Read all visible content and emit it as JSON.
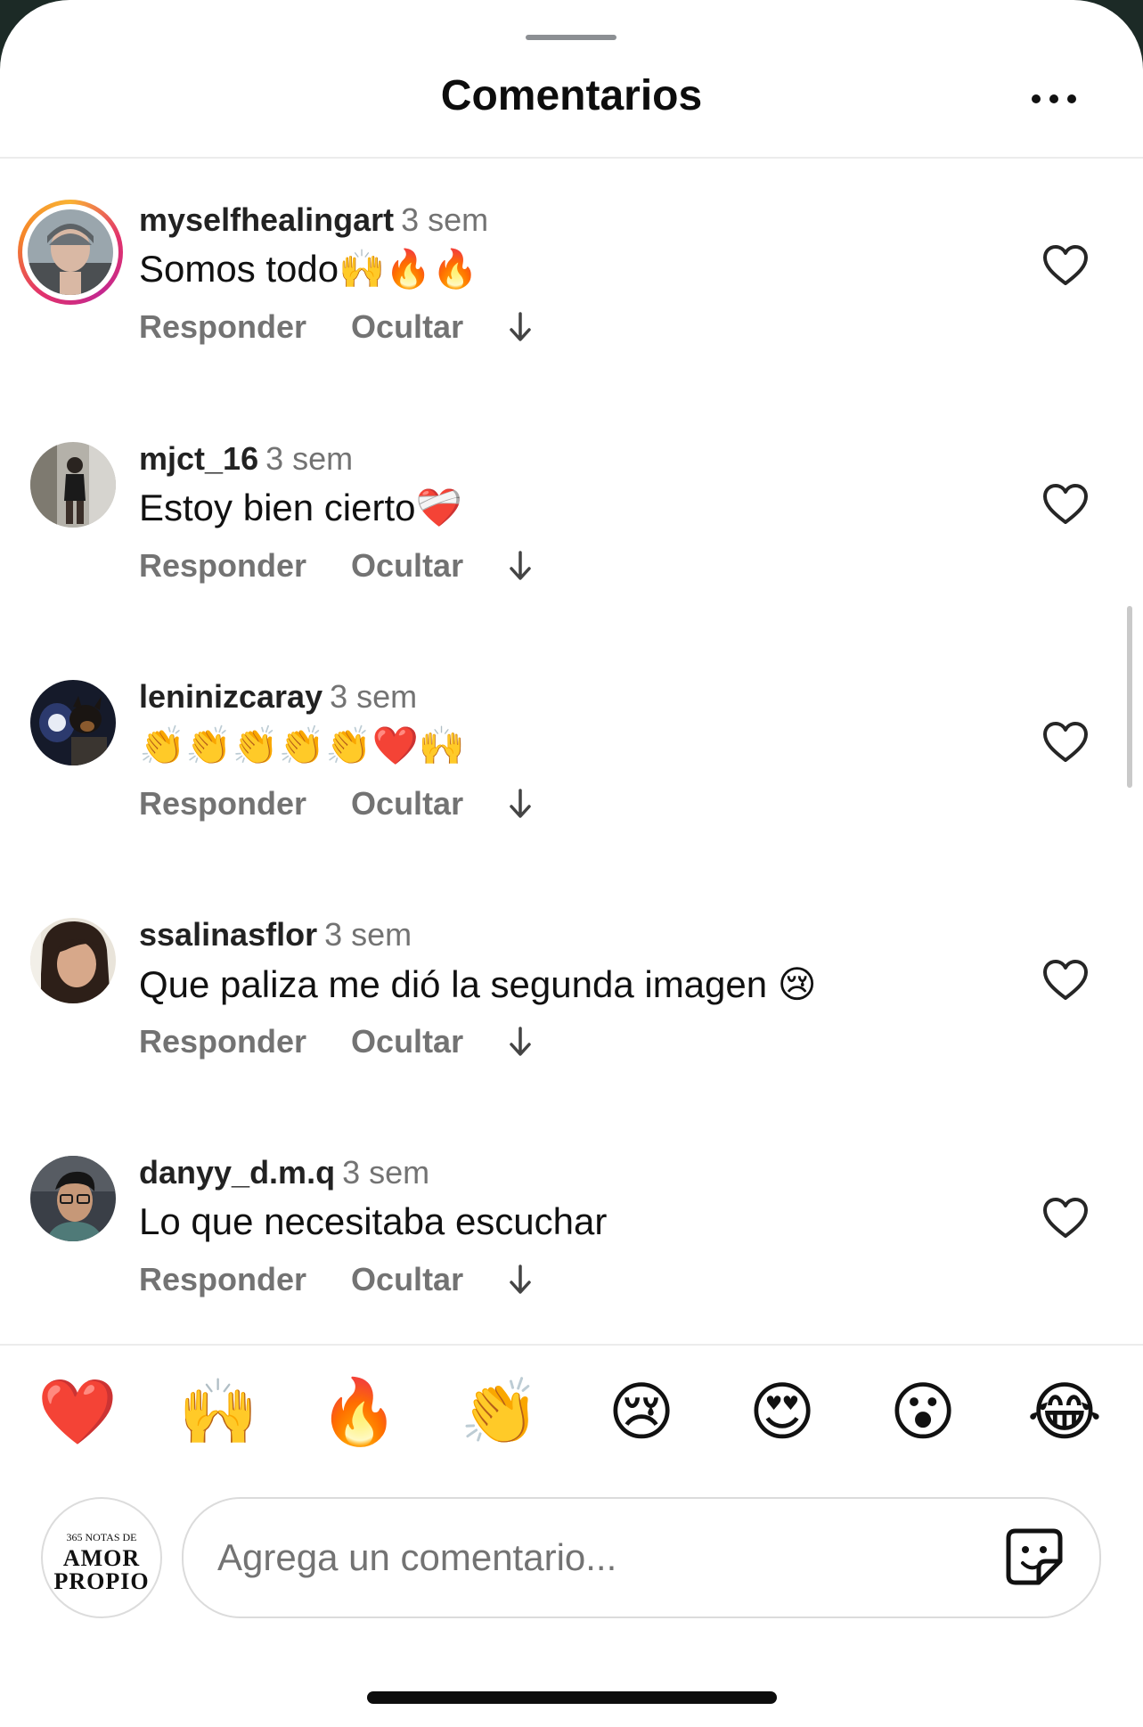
{
  "header": {
    "title": "Comentarios",
    "more_icon": "more-horizontal-icon"
  },
  "comments": [
    {
      "username": "myselfhealingart",
      "time": "3 sem",
      "text": "Somos todo🙌🔥🔥",
      "reply": "Responder",
      "hide": "Ocultar",
      "story_ring": true
    },
    {
      "username": "mjct_16",
      "time": "3 sem",
      "text": "Estoy bien cierto❤️‍🩹",
      "reply": "Responder",
      "hide": "Ocultar",
      "story_ring": false
    },
    {
      "username": "leninizcaray",
      "time": "3 sem",
      "text": "👏👏👏👏👏❤️🙌",
      "reply": "Responder",
      "hide": "Ocultar",
      "story_ring": false
    },
    {
      "username": "ssalinasflor",
      "time": "3 sem",
      "text": "Que paliza me dió la segunda imagen 😢",
      "reply": "Responder",
      "hide": "Ocultar",
      "story_ring": false
    },
    {
      "username": "danyy_d.m.q",
      "time": "3 sem",
      "text": "Lo que necesitaba escuchar",
      "reply": "Responder",
      "hide": "Ocultar",
      "story_ring": false
    }
  ],
  "reactions": [
    "❤️",
    "🙌",
    "🔥",
    "👏",
    "😢",
    "😍",
    "😮",
    "😂"
  ],
  "composer": {
    "avatar_text_1": "365 NOTAS DE",
    "avatar_text_2": "AMOR",
    "avatar_text_3": "PROPIO",
    "placeholder": "Agrega un comentario..."
  },
  "colors": {
    "background": "#ffffff",
    "muted": "#737373",
    "text": "#111111"
  }
}
